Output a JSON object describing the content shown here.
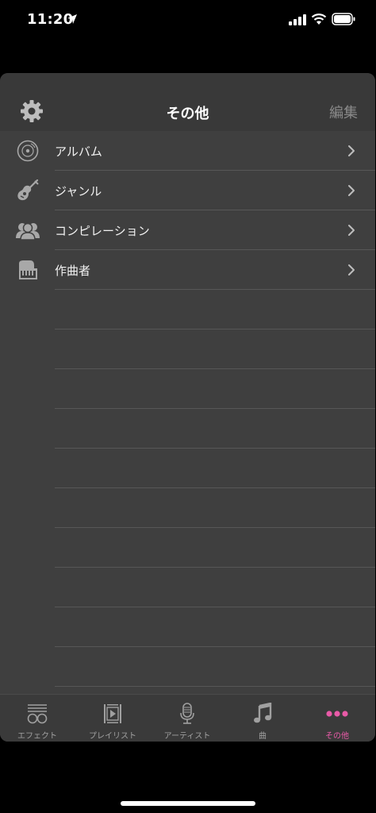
{
  "status": {
    "time": "11:20"
  },
  "nav": {
    "title": "その他",
    "edit_label": "編集"
  },
  "list": {
    "items": [
      {
        "label": "アルバム",
        "icon": "album-disc-icon"
      },
      {
        "label": "ジャンル",
        "icon": "guitar-icon"
      },
      {
        "label": "コンピレーション",
        "icon": "people-icon"
      },
      {
        "label": "作曲者",
        "icon": "piano-icon"
      }
    ]
  },
  "tabs": [
    {
      "label": "エフェクト",
      "icon": "effects-icon"
    },
    {
      "label": "プレイリスト",
      "icon": "playlist-icon"
    },
    {
      "label": "アーティスト",
      "icon": "microphone-icon"
    },
    {
      "label": "曲",
      "icon": "music-note-icon"
    },
    {
      "label": "その他",
      "icon": "more-dots-icon",
      "active": true
    }
  ],
  "colors": {
    "accent": "#e85aa7",
    "sheet": "#3f3f3f",
    "background": "#000000"
  }
}
